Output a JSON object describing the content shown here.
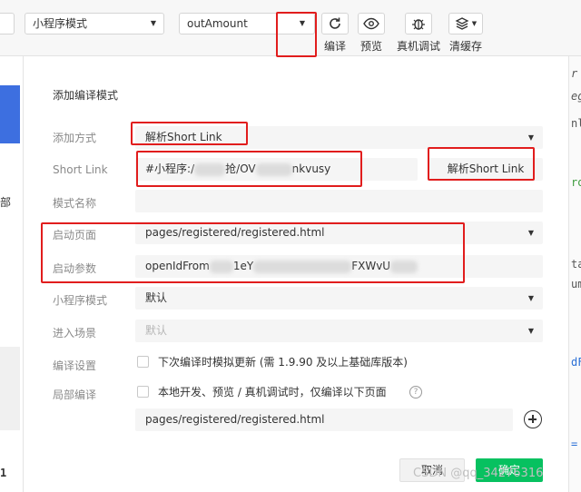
{
  "toolbar": {
    "mode_select": "小程序模式",
    "condition_select": "outAmount",
    "buttons": [
      {
        "label": "编译",
        "icon": "refresh-icon"
      },
      {
        "label": "预览",
        "icon": "eye-icon"
      },
      {
        "label": "真机调试",
        "icon": "bug-icon"
      },
      {
        "label": "清缓存",
        "icon": "layers-icon"
      }
    ]
  },
  "dialog": {
    "title": "添加编译模式",
    "add_method": {
      "label": "添加方式",
      "value": "解析Short Link"
    },
    "short_link": {
      "label": "Short Link",
      "prefix": "#小程序:/",
      "middle1": "抢/OV",
      "suffix": "nkvusy",
      "parse_button": "解析Short Link"
    },
    "mode_name": {
      "label": "模式名称",
      "value": ""
    },
    "start_page": {
      "label": "启动页面",
      "value": "pages/registered/registered.html"
    },
    "start_params": {
      "label": "启动参数",
      "prefix": "openIdFrom",
      "middle": "1eY",
      "suffix": "FXWvU"
    },
    "mini_mode": {
      "label": "小程序模式",
      "value": "默认"
    },
    "scene": {
      "label": "进入场景",
      "placeholder": "默认"
    },
    "compile_settings": {
      "label": "编译设置",
      "checkbox_text": "下次编译时模拟更新 (需 1.9.90 及以上基础库版本)"
    },
    "local_compile": {
      "label": "局部编译",
      "checkbox_text": "本地开发、预览 / 真机调试时，仅编译以下页面",
      "help": "?"
    },
    "local_page": {
      "value": "pages/registered/registered.html"
    },
    "cancel_button": "取消",
    "ok_button": "确定"
  },
  "watermark": "CSDN @qq_34276316",
  "right_edge": [
    "r",
    "eg",
    "nl",
    "ro",
    "ta",
    "um",
    "dF",
    "="
  ],
  "left_edge": [
    "部",
    "1"
  ],
  "annotation_color": "#e11d1d",
  "accent": "#07c160"
}
